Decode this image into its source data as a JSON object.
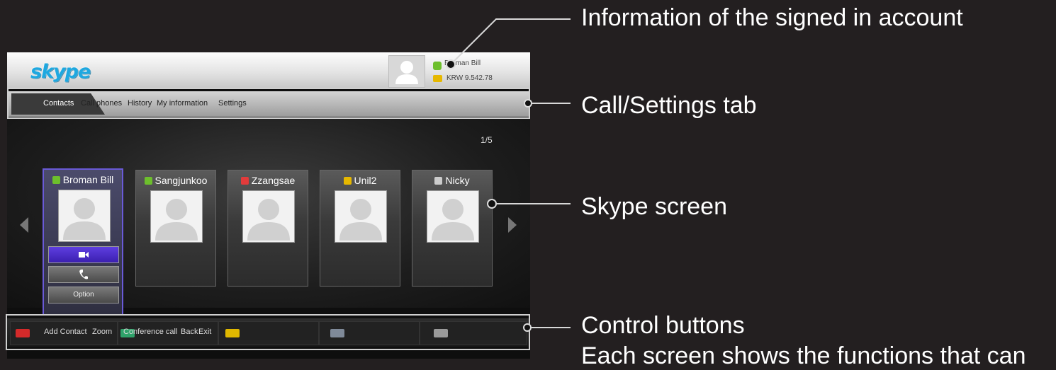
{
  "annotations": {
    "account": "Information of the signed in account",
    "tabs": "Call/Settings tab",
    "screen": "Skype screen",
    "controls": "Control buttons",
    "controls_sub": "Each screen shows the functions that can"
  },
  "header": {
    "logo": "skype",
    "account_name": "Broman Bill",
    "account_credit": "KRW 9.542.78"
  },
  "tabs": [
    "Contacts",
    "Call phones",
    "History",
    "My information",
    "Settings"
  ],
  "page_counter": "1/5",
  "contacts": [
    {
      "name": "Broman Bill",
      "status": "online",
      "status_color": "#6dbf2c"
    },
    {
      "name": "Sangjunkoo",
      "status": "online",
      "status_color": "#6dbf2c"
    },
    {
      "name": "Zzangsae",
      "status": "busy",
      "status_color": "#e23b3b"
    },
    {
      "name": "Unil2",
      "status": "away",
      "status_color": "#e6b800"
    },
    {
      "name": "Nicky",
      "status": "offline",
      "status_color": "#cccccc"
    }
  ],
  "card_buttons": {
    "video": "video-icon",
    "call": "phone-icon",
    "option": "Option"
  },
  "control_bar": {
    "red_label": "Add Contact",
    "green_label": "Zoom",
    "yellow_label": "Conference call",
    "blue_label": "Back",
    "exit_label": "Exit",
    "key_colors": {
      "red": "#d42a2a",
      "green": "#2fa36a",
      "yellow": "#e0b800",
      "blue": "#7f8a99",
      "exit": "#9a9a9a"
    }
  }
}
